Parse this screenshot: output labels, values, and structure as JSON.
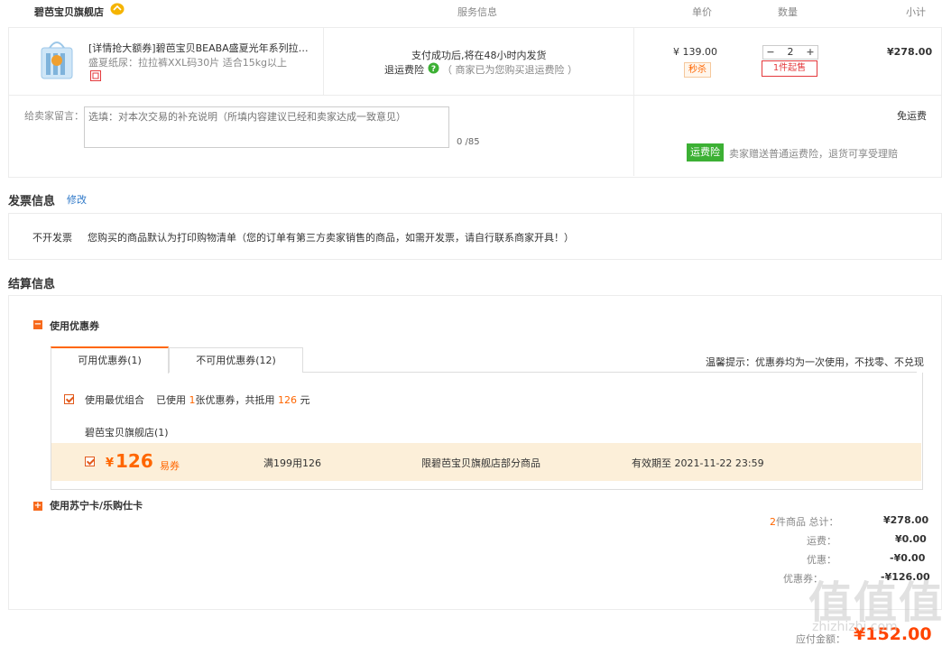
{
  "store": {
    "name": "碧芭宝贝旗舰店"
  },
  "headers": {
    "service": "服务信息",
    "unit_price": "单价",
    "quantity": "数量",
    "subtotal": "小计"
  },
  "product": {
    "title": "[详情抢大额券]碧芭宝贝BEABA盛夏光年系列拉…",
    "spec": "盛夏纸尿：拉拉裤XXL码30片 适合15kg以上",
    "service_line1": "支付成功后,将在48小时内发货",
    "return_insurance_label": "退运费险",
    "return_insurance_note": "（ 商家已为您购买退运费险 ）",
    "price": "¥ 139.00",
    "flash_badge": "秒杀",
    "qty": "2",
    "min_qty": "1件起售",
    "subtotal": "¥278.00"
  },
  "message": {
    "label": "给卖家留言：",
    "placeholder": "选填：对本次交易的补充说明（所填内容建议已经和卖家达成一致意见）",
    "counter": "0 /85",
    "shipping": "免运费",
    "insurance_badge": "运费险",
    "insurance_desc": "卖家赠送普通运费险，退货可享受理赔"
  },
  "invoice": {
    "title": "发票信息",
    "edit": "修改",
    "type": "不开发票",
    "desc": "您购买的商品默认为打印购物清单（您的订单有第三方卖家销售的商品，如需开发票，请自行联系商家开具！）"
  },
  "settlement": {
    "title": "结算信息",
    "use_coupon": "使用优惠券",
    "tab_available": "可用优惠券(1)",
    "tab_unavailable": "不可用优惠券(12)",
    "tip": "温馨提示：优惠券均为一次使用，不找零、不兑现",
    "best_combo_label": "使用最优组合",
    "best_combo_p1": "已使用",
    "best_combo_count": "1",
    "best_combo_p2": "张优惠券，共抵用",
    "best_combo_amount": "126",
    "best_combo_p3": "元",
    "coupon_store": "碧芭宝贝旗舰店(1)",
    "coupon_symbol": "¥",
    "coupon_amount": "126",
    "coupon_type": "易券",
    "coupon_condition": "满199用126",
    "coupon_scope": "限碧芭宝贝旗舰店部分商品",
    "coupon_expiry": "有效期至 2021-11-22 23:59",
    "use_card": "使用苏宁卡/乐购仕卡"
  },
  "summary": {
    "count": "2",
    "count_suffix": "件商品 总计：",
    "total": "¥278.00",
    "shipping_label": "运费：",
    "shipping": "¥0.00",
    "discount_label": "优惠：",
    "discount": "-¥0.00",
    "coupon_label": "优惠券：",
    "coupon": "-¥126.00",
    "payable_label": "应付金额：",
    "payable": "¥152.00"
  },
  "watermark": {
    "text": "值值值",
    "sub": "zhizhizhi.com"
  },
  "colors": {
    "accent": "#ff6600",
    "green": "#3cb034",
    "coupon_bg": "#fcefd9",
    "red": "#e4393c"
  }
}
